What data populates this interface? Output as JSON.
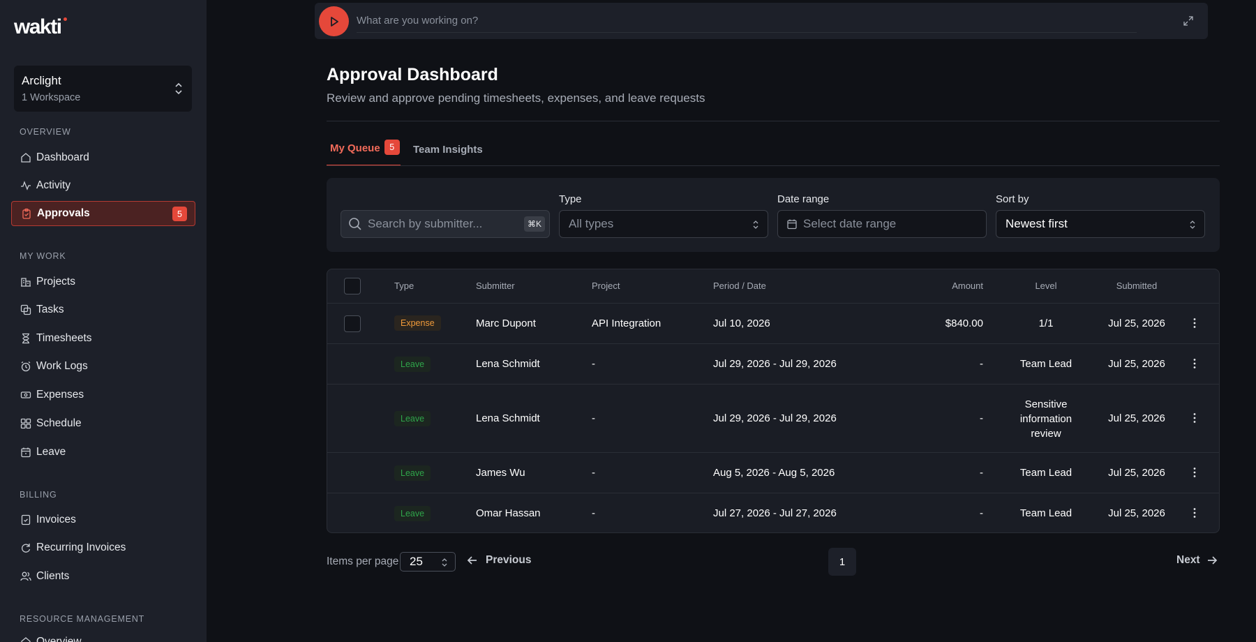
{
  "app": {
    "logo": "wakti"
  },
  "workspace": {
    "name": "Arclight",
    "subtitle": "1 Workspace"
  },
  "sidebar": {
    "sections": {
      "overview": "OVERVIEW",
      "my_work": "MY WORK",
      "billing": "BILLING",
      "resource": "RESOURCE MANAGEMENT"
    },
    "items": {
      "dashboard": "Dashboard",
      "activity": "Activity",
      "approvals": "Approvals",
      "approvals_badge": "5",
      "projects": "Projects",
      "tasks": "Tasks",
      "timesheets": "Timesheets",
      "work_logs": "Work Logs",
      "expenses": "Expenses",
      "schedule": "Schedule",
      "leave": "Leave",
      "invoices": "Invoices",
      "recurring_invoices": "Recurring Invoices",
      "clients": "Clients",
      "overview_partial": "Overview"
    }
  },
  "timer": {
    "placeholder": "What are you working on?"
  },
  "header": {
    "title": "Approval Dashboard",
    "subtitle": "Review and approve pending timesheets, expenses, and leave requests"
  },
  "tabs": {
    "my_queue": "My Queue",
    "my_queue_badge": "5",
    "team_insights": "Team Insights"
  },
  "filters": {
    "search_placeholder": "Search by submitter...",
    "search_shortcut": "⌘K",
    "type_label": "Type",
    "type_value": "All types",
    "date_label": "Date range",
    "date_placeholder": "Select date range",
    "sort_label": "Sort by",
    "sort_value": "Newest first"
  },
  "table": {
    "headers": {
      "type": "Type",
      "submitter": "Submitter",
      "project": "Project",
      "period": "Period / Date",
      "amount": "Amount",
      "level": "Level",
      "submitted": "Submitted"
    },
    "rows": [
      {
        "type": "Expense",
        "submitter": "Marc Dupont",
        "project": "API Integration",
        "period": "Jul 10, 2026",
        "amount": "$840.00",
        "level": "1/1",
        "submitted": "Jul 25, 2026"
      },
      {
        "type": "Leave",
        "submitter": "Lena Schmidt",
        "project": "-",
        "period": "Jul 29, 2026 - Jul 29, 2026",
        "amount": "-",
        "level": "Team Lead",
        "submitted": "Jul 25, 2026"
      },
      {
        "type": "Leave",
        "submitter": "Lena Schmidt",
        "project": "-",
        "period": "Jul 29, 2026 - Jul 29, 2026",
        "amount": "-",
        "level_line1": "Sensitive",
        "level_line2": "information",
        "level_line3": "review",
        "submitted": "Jul 25, 2026"
      },
      {
        "type": "Leave",
        "submitter": "James Wu",
        "project": "-",
        "period": "Aug 5, 2026 - Aug 5, 2026",
        "amount": "-",
        "level": "Team Lead",
        "submitted": "Jul 25, 2026"
      },
      {
        "type": "Leave",
        "submitter": "Omar Hassan",
        "project": "-",
        "period": "Jul 27, 2026 - Jul 27, 2026",
        "amount": "-",
        "level": "Team Lead",
        "submitted": "Jul 25, 2026"
      }
    ]
  },
  "pagination": {
    "items_per_page_label": "Items per page",
    "items_per_page": "25",
    "previous": "Previous",
    "current_page": "1",
    "next": "Next"
  },
  "colors": {
    "accent": "#e5483a",
    "expense": "#f09a3a",
    "leave": "#2fa54a"
  }
}
